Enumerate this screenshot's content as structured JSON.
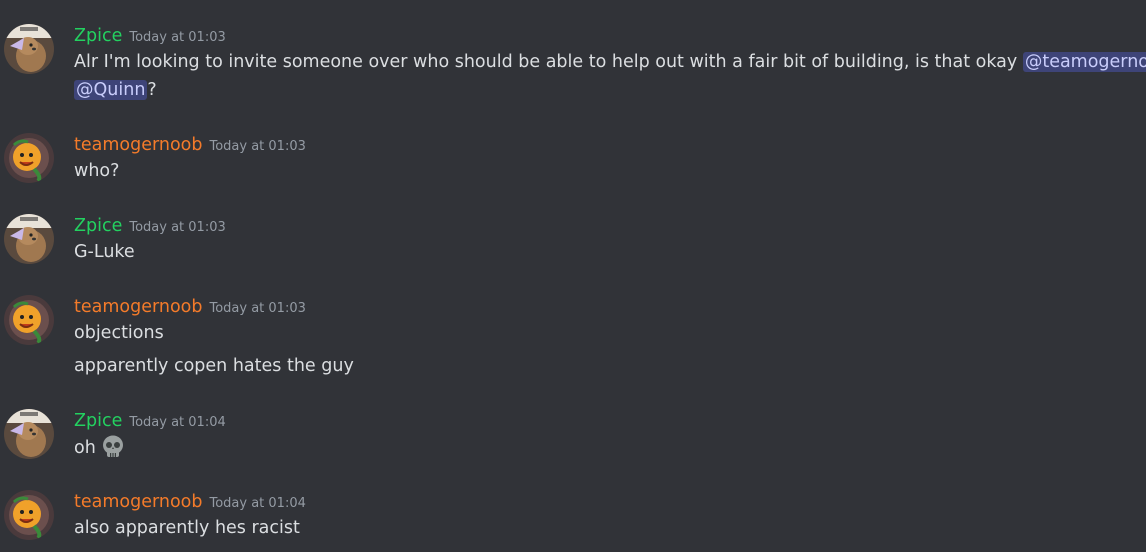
{
  "colors": {
    "background": "#313338",
    "zpice": "#23d160",
    "teamogernoob": "#f47b2a",
    "text": "#dbdee1",
    "timestamp": "#949ba4",
    "mention_bg": "#3c4270",
    "mention_text": "#c9cdfb"
  },
  "messages": [
    {
      "author": "Zpice",
      "timestamp": "Today at 01:03",
      "avatar_icon": "dog-avatar-icon",
      "line1_text": "Alr I'm looking to invite someone over who should be able to help out with a fair bit of building, is that okay ",
      "mention1": "@teamogernoob",
      "mention2": "@Quinn",
      "line2_suffix": "?"
    },
    {
      "author": "teamogernoob",
      "timestamp": "Today at 01:03",
      "avatar_icon": "orange-character-avatar-icon",
      "lines": [
        "who?"
      ]
    },
    {
      "author": "Zpice",
      "timestamp": "Today at 01:03",
      "avatar_icon": "dog-avatar-icon",
      "lines": [
        "G-Luke"
      ]
    },
    {
      "author": "teamogernoob",
      "timestamp": "Today at 01:03",
      "avatar_icon": "orange-character-avatar-icon",
      "lines": [
        "objections",
        "apparently copen hates the guy"
      ]
    },
    {
      "author": "Zpice",
      "timestamp": "Today at 01:04",
      "avatar_icon": "dog-avatar-icon",
      "lines": [
        "oh"
      ],
      "emoji": "skull-emoji-icon"
    },
    {
      "author": "teamogernoob",
      "timestamp": "Today at 01:04",
      "avatar_icon": "orange-character-avatar-icon",
      "lines": [
        "also apparently hes racist"
      ]
    }
  ]
}
